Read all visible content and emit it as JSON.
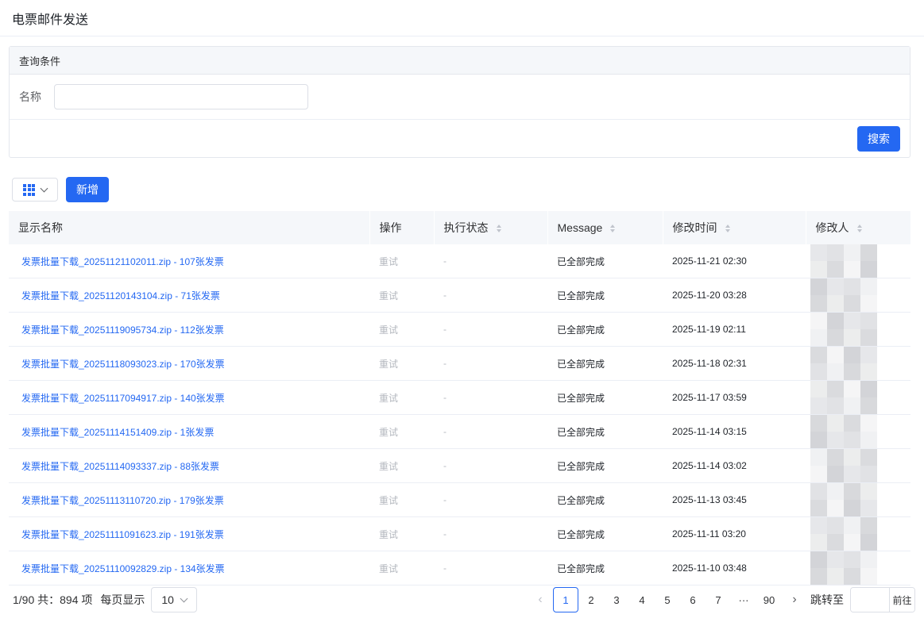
{
  "page": {
    "title": "电票邮件发送"
  },
  "query": {
    "header": "查询条件",
    "name_label": "名称",
    "name_value": "",
    "name_placeholder": "",
    "search_label": "搜索"
  },
  "toolbar": {
    "add_label": "新增",
    "view_icon": "grid-icon",
    "dropdown_icon": "chevron-down-icon"
  },
  "table": {
    "columns": [
      "显示名称",
      "操作",
      "执行状态",
      "Message",
      "修改时间",
      "修改人"
    ],
    "rows": [
      {
        "name": "发票批量下载_20251121102011.zip - 107张发票",
        "action": "重试",
        "exec_status": "-",
        "message": "已全部完成",
        "modified_time": "2025-11-21 02:30"
      },
      {
        "name": "发票批量下载_20251120143104.zip - 71张发票",
        "action": "重试",
        "exec_status": "-",
        "message": "已全部完成",
        "modified_time": "2025-11-20 03:28"
      },
      {
        "name": "发票批量下载_20251119095734.zip - 112张发票",
        "action": "重试",
        "exec_status": "-",
        "message": "已全部完成",
        "modified_time": "2025-11-19 02:11"
      },
      {
        "name": "发票批量下载_20251118093023.zip - 170张发票",
        "action": "重试",
        "exec_status": "-",
        "message": "已全部完成",
        "modified_time": "2025-11-18 02:31"
      },
      {
        "name": "发票批量下载_20251117094917.zip - 140张发票",
        "action": "重试",
        "exec_status": "-",
        "message": "已全部完成",
        "modified_time": "2025-11-17 03:59"
      },
      {
        "name": "发票批量下载_20251114151409.zip - 1张发票",
        "action": "重试",
        "exec_status": "-",
        "message": "已全部完成",
        "modified_time": "2025-11-14 03:15"
      },
      {
        "name": "发票批量下载_20251114093337.zip - 88张发票",
        "action": "重试",
        "exec_status": "-",
        "message": "已全部完成",
        "modified_time": "2025-11-14 03:02"
      },
      {
        "name": "发票批量下载_20251113110720.zip - 179张发票",
        "action": "重试",
        "exec_status": "-",
        "message": "已全部完成",
        "modified_time": "2025-11-13 03:45"
      },
      {
        "name": "发票批量下载_20251111091623.zip - 191张发票",
        "action": "重试",
        "exec_status": "-",
        "message": "已全部完成",
        "modified_time": "2025-11-11 03:20"
      },
      {
        "name": "发票批量下载_20251110092829.zip - 134张发票",
        "action": "重试",
        "exec_status": "-",
        "message": "已全部完成",
        "modified_time": "2025-11-10 03:48"
      }
    ]
  },
  "pagination": {
    "total_text": "1/90 共：894 项",
    "page_size_label": "每页显示",
    "page_size": "10",
    "pages": [
      "1",
      "2",
      "3",
      "4",
      "5",
      "6",
      "7",
      "···",
      "90"
    ],
    "current_page": "1",
    "prev_icon": "‹",
    "next_icon": "›",
    "jump_label": "跳转至",
    "jump_value": "",
    "go_label": "前往"
  },
  "colors": {
    "primary": "#2468f2",
    "header_bg": "#f5f7fa",
    "muted_text": "#b4b8bf"
  }
}
